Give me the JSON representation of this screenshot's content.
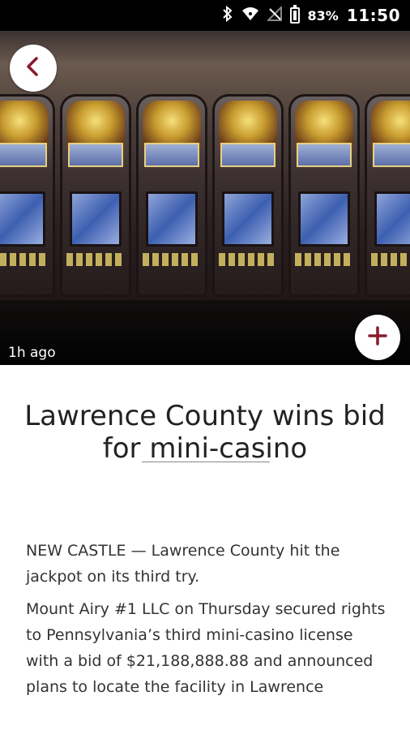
{
  "status_bar": {
    "battery_percent": "83%",
    "time": "11:50",
    "icons": [
      "bluetooth-icon",
      "wifi-icon",
      "signal-icon",
      "battery-icon"
    ]
  },
  "hero": {
    "time_ago": "1h ago",
    "back_icon": "chevron-left-icon",
    "add_icon": "plus-icon",
    "accent_color": "#8b1a2b"
  },
  "article": {
    "headline": "Lawrence County wins bid for mini-casino",
    "paragraphs": [
      "NEW CASTLE — Lawrence County hit the jackpot on its third try.",
      "Mount Airy #1 LLC on Thursday secured rights to Pennsylvania’s third mini-casino license with a bid of $21,188,888.88 and announced plans to locate the facility in Lawrence"
    ]
  }
}
